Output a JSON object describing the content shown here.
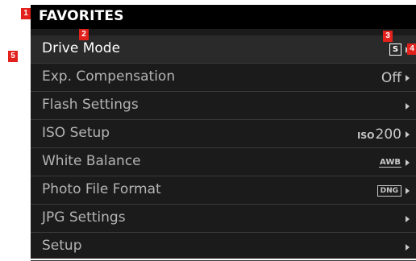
{
  "header": {
    "title": "FAVORITES"
  },
  "menu": {
    "items": [
      {
        "label": "Drive Mode",
        "value": "",
        "icon": "single-shot-icon",
        "icon_text": "S"
      },
      {
        "label": "Exp. Compensation",
        "value": "Off",
        "icon": ""
      },
      {
        "label": "Flash Settings",
        "value": "",
        "icon": ""
      },
      {
        "label": "ISO Setup",
        "iso_prefix": "ISO",
        "value": "200",
        "icon": ""
      },
      {
        "label": "White Balance",
        "value": "",
        "icon": "awb-icon",
        "icon_text": "AWB"
      },
      {
        "label": "Photo File Format",
        "value": "",
        "icon": "dng-icon",
        "icon_text": "DNG"
      },
      {
        "label": "JPG Settings",
        "value": "",
        "icon": ""
      },
      {
        "label": "Setup",
        "value": "",
        "icon": ""
      }
    ]
  },
  "annotations": [
    "1",
    "2",
    "3",
    "4",
    "5"
  ],
  "colors": {
    "marker": "#e2211c",
    "background": "#1b1b1b",
    "header": "#000000",
    "selected_row": "#2a2a2a"
  }
}
